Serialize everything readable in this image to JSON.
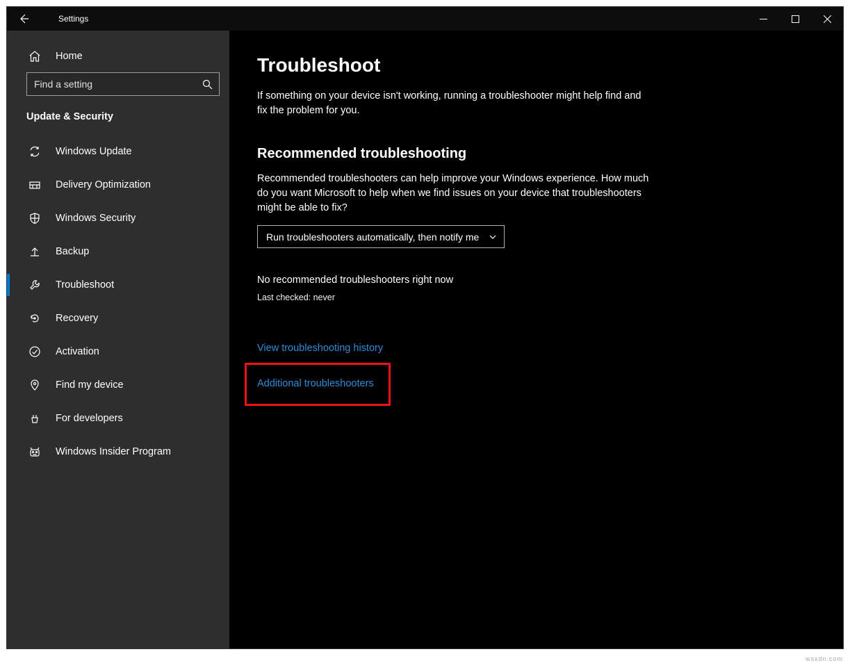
{
  "app_title": "Settings",
  "home_label": "Home",
  "search_placeholder": "Find a setting",
  "section_title": "Update & Security",
  "nav": [
    {
      "label": "Windows Update",
      "icon": "sync"
    },
    {
      "label": "Delivery Optimization",
      "icon": "delivery"
    },
    {
      "label": "Windows Security",
      "icon": "shield"
    },
    {
      "label": "Backup",
      "icon": "backup"
    },
    {
      "label": "Troubleshoot",
      "icon": "troubleshoot",
      "active": true
    },
    {
      "label": "Recovery",
      "icon": "recovery"
    },
    {
      "label": "Activation",
      "icon": "activation"
    },
    {
      "label": "Find my device",
      "icon": "findmydevice"
    },
    {
      "label": "For developers",
      "icon": "developers"
    },
    {
      "label": "Windows Insider Program",
      "icon": "insider"
    }
  ],
  "page": {
    "title": "Troubleshoot",
    "intro": "If something on your device isn't working, running a troubleshooter might help find and fix the problem for you.",
    "section_heading": "Recommended troubleshooting",
    "section_desc": "Recommended troubleshooters can help improve your Windows experience. How much do you want Microsoft to help when we find issues on your device that troubleshooters might be able to fix?",
    "dropdown_value": "Run troubleshooters automatically, then notify me",
    "status": "No recommended troubleshooters right now",
    "last_checked": "Last checked: never",
    "link_history": "View troubleshooting history",
    "link_additional": "Additional troubleshooters"
  },
  "attribution": "wsxdn.com"
}
